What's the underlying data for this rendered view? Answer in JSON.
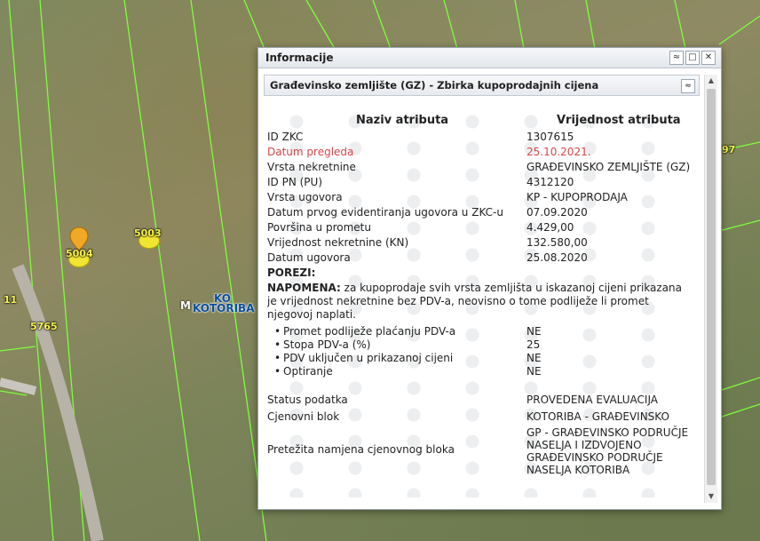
{
  "map": {
    "parcel_labels": [
      {
        "id": "p5003",
        "text": "5003"
      },
      {
        "id": "p5004",
        "text": "5004"
      },
      {
        "id": "p5765",
        "text": "5765"
      },
      {
        "id": "p11",
        "text": "11"
      },
      {
        "id": "p97",
        "text": "97"
      }
    ],
    "place_label_top": "KO",
    "place_label": "KOTORIBA",
    "place_label_prefix": "M"
  },
  "window": {
    "title": "Informacije",
    "section_title": "Građevinsko zemljište (GZ) - Zbirka kupoprodajnih cijena",
    "col_attr": "Naziv atributa",
    "col_value": "Vrijednost atributa",
    "rows": [
      {
        "k": "ID ZKC",
        "v": "1307615"
      },
      {
        "k": "Datum pregleda",
        "v": "25.10.2021."
      },
      {
        "k": "Vrsta nekretnine",
        "v": "GRAĐEVINSKO ZEMLJIŠTE (GZ)"
      },
      {
        "k": "ID PN (PU)",
        "v": "4312120"
      },
      {
        "k": "Vrsta ugovora",
        "v": "KP - KUPOPRODAJA"
      },
      {
        "k": "Datum prvog evidentiranja ugovora u ZKC-u",
        "v": "07.09.2020"
      },
      {
        "k": "Površina u prometu",
        "v": "4.429,00"
      },
      {
        "k": "Vrijednost nekretnine (KN)",
        "v": "132.580,00"
      },
      {
        "k": "Datum ugovora",
        "v": "25.08.2020"
      }
    ],
    "porezi_label": "POREZI:",
    "napomena_label": "NAPOMENA:",
    "napomena_text": " za kupoprodaje svih vrsta zemljišta u iskazanoj cijeni prikazana je vrijednost nekretnine bez PDV-a, neovisno o tome podliježe li promet njegovoj naplati.",
    "tax_items": [
      {
        "k": "Promet podliježe plaćanju PDV-a",
        "v": "NE"
      },
      {
        "k": "Stopa PDV-a (%)",
        "v": "25"
      },
      {
        "k": "PDV uključen u prikazanoj cijeni",
        "v": "NE"
      },
      {
        "k": "Optiranje",
        "v": "NE"
      }
    ],
    "status_label": "Status podatka",
    "status_value": "PROVEDENA EVALUACIJA",
    "blok_label": "Cjenovni blok",
    "blok_value": "KOTORIBA - GRAĐEVINSKO",
    "namjena_label": "Pretežita namjena cjenovnog bloka",
    "namjena_value": [
      "GP - GRAĐEVINSKO PODRUČJE",
      "NASELJA I IZDVOJENO",
      "GRAĐEVINSKO PODRUČJE",
      "NASELJA KOTORIBA"
    ]
  },
  "icons": {
    "window_controls": [
      "collapse-icon",
      "restore-icon",
      "close-icon"
    ]
  },
  "colors": {
    "highlight_red": "#d8454a",
    "parcel_label": "#f7f24a",
    "boundary": "#7dff3c"
  }
}
